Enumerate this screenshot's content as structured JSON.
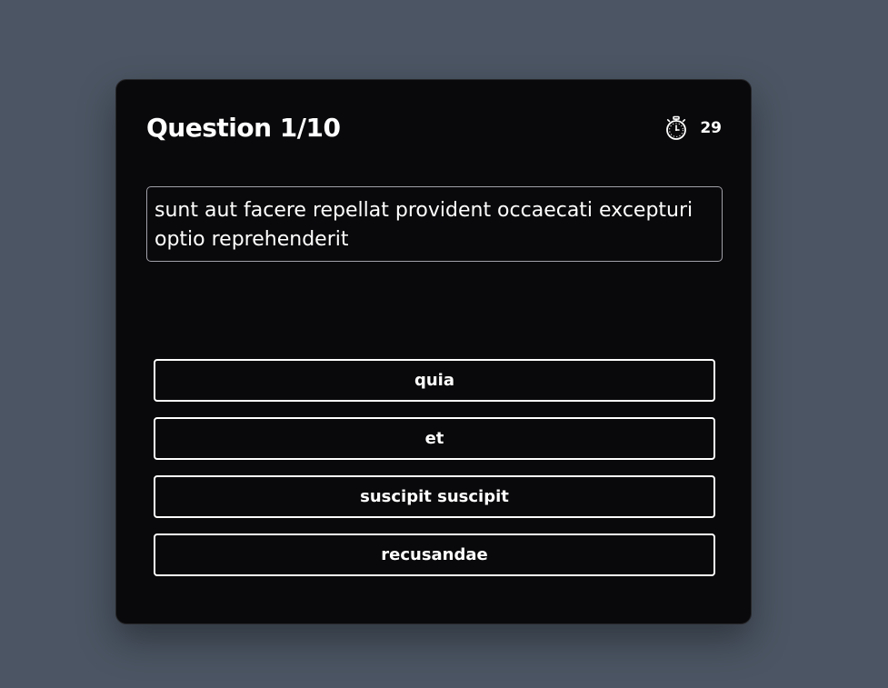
{
  "quiz": {
    "title": "Question 1/10",
    "timer": {
      "icon": "stopwatch-icon",
      "value": "29"
    },
    "question": "sunt aut facere repellat provident occaecati excepturi optio reprehenderit",
    "answers": [
      "quia",
      "et",
      "suscipit suscipit",
      "recusandae"
    ]
  },
  "colors": {
    "page_background": "#4b5563",
    "card_background": "#09090b",
    "text": "#ffffff",
    "question_border": "#a1a1aa",
    "answer_border": "#ffffff"
  }
}
